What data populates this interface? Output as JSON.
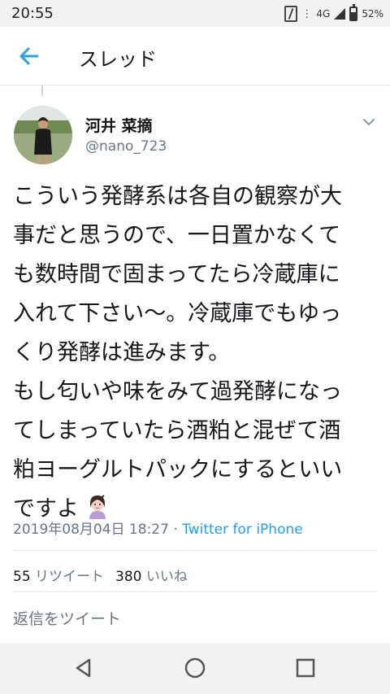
{
  "status_bar": {
    "time": "20:55",
    "network": "4G",
    "battery": "52%"
  },
  "header": {
    "title": "スレッド"
  },
  "tweet": {
    "author": {
      "name": "河井 菜摘",
      "handle": "@nano_723"
    },
    "text_lines": [
      "こういう発酵系は各自の観察が大",
      "事だと思うので、一日置かなくて",
      "も数時間で固まってたら冷蔵庫に",
      "入れて下さい〜。冷蔵庫でもゆっ",
      "くり発酵は進みます。",
      "もし匂いや味をみて過発酵になっ",
      "てしまっていたら酒粕と混ぜて酒",
      "粕ヨーグルトパックにするといい",
      "ですよ"
    ],
    "timestamp": "2019年08月04日 18:27",
    "separator": " · ",
    "source": "Twitter for iPhone",
    "retweets_count": "55",
    "retweets_label": "リツイート",
    "likes_count": "380",
    "likes_label": "いいね"
  },
  "reply": {
    "placeholder": "返信をツイート"
  },
  "colors": {
    "accent": "#1da1f2",
    "secondary_text": "#657786",
    "divider": "#e6ecf0"
  },
  "icons": {
    "back": "back-arrow-icon",
    "caret": "chevron-down-icon",
    "nav_back": "triangle-back-icon",
    "nav_home": "circle-home-icon",
    "nav_recents": "square-recents-icon"
  }
}
